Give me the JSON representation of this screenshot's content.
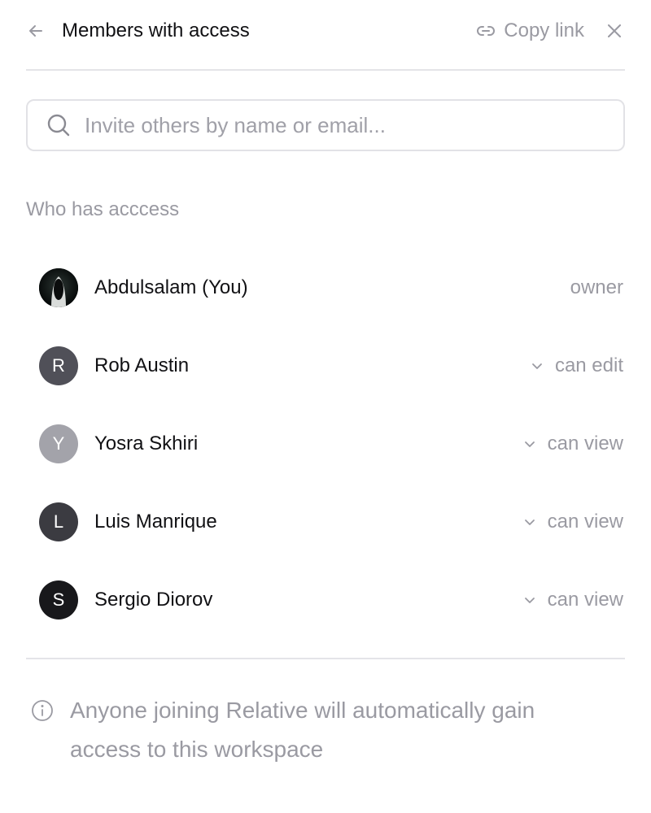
{
  "header": {
    "title": "Members with access",
    "copy_link_label": "Copy link"
  },
  "search": {
    "placeholder": "Invite others by name or email...",
    "value": ""
  },
  "access": {
    "section_label": "Who has acccess",
    "members": [
      {
        "name": "Abdulsalam (You)",
        "initial": "",
        "avatar_type": "photo",
        "role": "owner",
        "role_editable": false
      },
      {
        "name": "Rob Austin",
        "initial": "R",
        "avatar_color": "#505058",
        "role": "can edit",
        "role_editable": true
      },
      {
        "name": "Yosra Skhiri",
        "initial": "Y",
        "avatar_color": "#a3a3aa",
        "role": "can view",
        "role_editable": true
      },
      {
        "name": "Luis Manrique",
        "initial": "L",
        "avatar_color": "#3b3b41",
        "role": "can view",
        "role_editable": true
      },
      {
        "name": "Sergio Diorov",
        "initial": "S",
        "avatar_color": "#18181b",
        "role": "can view",
        "role_editable": true
      }
    ]
  },
  "footer": {
    "info_text": "Anyone joining Relative will automatically gain access to this workspace"
  },
  "icons": {
    "back": "arrow-left-icon",
    "copy": "link-icon",
    "close": "close-icon",
    "search": "search-icon",
    "chevron": "chevron-down-icon",
    "info": "info-icon"
  },
  "colors": {
    "text_primary": "#111114",
    "text_muted": "#9a9aa2",
    "border": "#e4e4e8"
  }
}
